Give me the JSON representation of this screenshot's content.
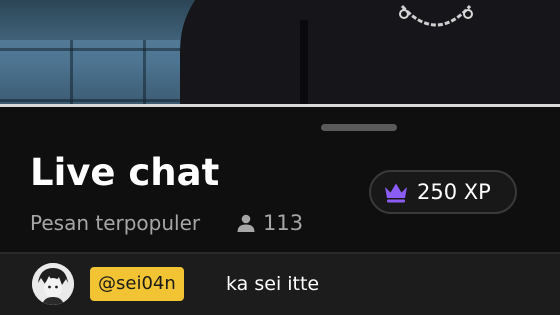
{
  "chat_panel": {
    "title": "Live chat",
    "filter_label": "Pesan terpopuler",
    "viewer_count": "113",
    "xp_label": "250 XP"
  },
  "messages": [
    {
      "username": "@sei04n",
      "text": "ka sei itte"
    }
  ],
  "icons": {
    "viewers": "person-icon",
    "xp": "crown-icon"
  },
  "colors": {
    "accent_crown": "#8b5cf6",
    "username_badge": "#f2c433",
    "background": "#0f0f0f"
  }
}
